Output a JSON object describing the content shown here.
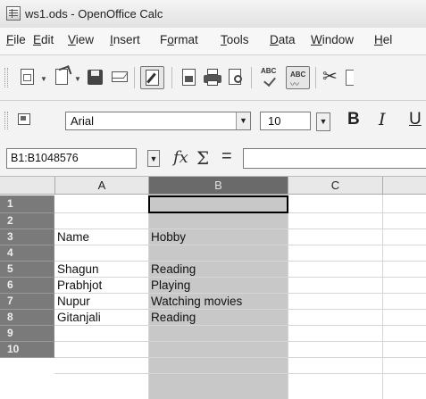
{
  "window": {
    "title": "ws1.ods - OpenOffice Calc"
  },
  "menu": [
    {
      "label": "File",
      "underline": "F",
      "rest": "ile"
    },
    {
      "label": "Edit",
      "underline": "E",
      "rest": "dit"
    },
    {
      "label": "View",
      "underline": "V",
      "rest": "iew"
    },
    {
      "label": "Insert",
      "underline": "I",
      "rest": "nsert"
    },
    {
      "label": "Format",
      "pre": "F",
      "underline": "o",
      "rest": "rmat"
    },
    {
      "label": "Tools",
      "underline": "T",
      "rest": "ools"
    },
    {
      "label": "Data",
      "underline": "D",
      "rest": "ata"
    },
    {
      "label": "Window",
      "underline": "W",
      "rest": "indow"
    },
    {
      "label": "Hel",
      "underline": "H",
      "rest": "el"
    }
  ],
  "toolbar": {
    "icons": [
      "new-icon",
      "open-icon",
      "save-icon",
      "email-icon",
      "edit-file-icon",
      "export-pdf-icon",
      "print-icon",
      "page-preview-icon",
      "spellcheck-icon",
      "autospellcheck-icon",
      "cut-icon"
    ],
    "spell_label": "ABC"
  },
  "format_toolbar": {
    "font_name": "Arial",
    "font_size": "10",
    "bold_label": "B",
    "italic_label": "I",
    "underline_label": "U"
  },
  "formula_bar": {
    "name_box": "B1:B1048576",
    "fx_label": "fx",
    "sum_label": "Σ",
    "equals_label": "=",
    "content": ""
  },
  "sheet": {
    "columns": [
      "A",
      "B",
      "C"
    ],
    "selected_column": "B",
    "rows": [
      "1",
      "2",
      "3",
      "4",
      "5",
      "6",
      "7",
      "8",
      "9",
      "10"
    ],
    "cells": [
      {
        "row": "3",
        "col": "A",
        "value": "Name"
      },
      {
        "row": "3",
        "col": "B",
        "value": "Hobby"
      },
      {
        "row": "5",
        "col": "A",
        "value": "Shagun"
      },
      {
        "row": "5",
        "col": "B",
        "value": "Reading"
      },
      {
        "row": "6",
        "col": "A",
        "value": "Prabhjot"
      },
      {
        "row": "6",
        "col": "B",
        "value": "Playing"
      },
      {
        "row": "7",
        "col": "A",
        "value": "Nupur"
      },
      {
        "row": "7",
        "col": "B",
        "value": "Watching movies"
      },
      {
        "row": "8",
        "col": "A",
        "value": "Gitanjali"
      },
      {
        "row": "8",
        "col": "B",
        "value": "Reading"
      }
    ]
  }
}
